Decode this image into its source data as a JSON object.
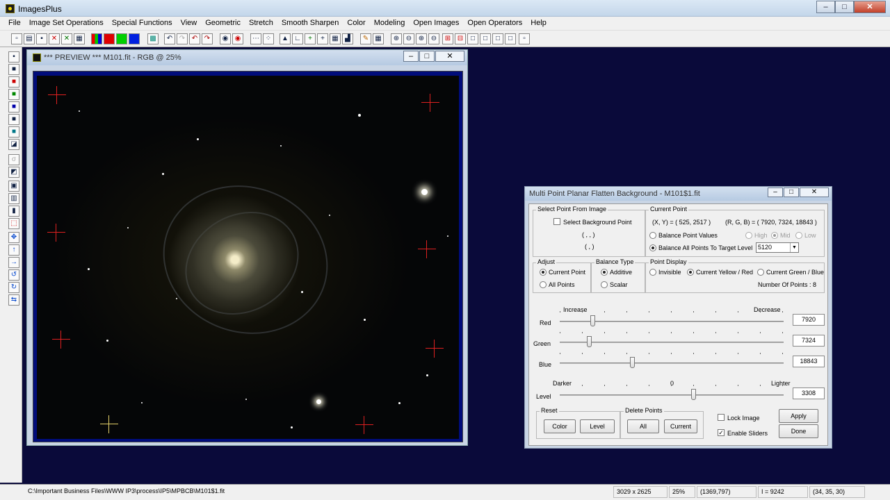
{
  "app": {
    "title": "ImagesPlus"
  },
  "menu": [
    "File",
    "Image Set Operations",
    "Special Functions",
    "View",
    "Geometric",
    "Stretch",
    "Smooth Sharpen",
    "Color",
    "Modeling",
    "Open Images",
    "Open Operators",
    "Help"
  ],
  "preview": {
    "title": "*** PREVIEW *** M101.fit - RGB @ 25%"
  },
  "dialog": {
    "title": "Multi Point Planar Flatten Background - M101$1.fit",
    "select_point": {
      "legend": "Select Point From Image",
      "checkbox_label": "Select Background Point",
      "coord_xyz": "( , , )",
      "coord_xy": "( , )"
    },
    "current_point": {
      "legend": "Current Point",
      "xy": "(X, Y) = ( 525, 2517 )",
      "rgb": "(R, G, B) = ( 7920, 7324, 18843 )",
      "balance_values": "Balance Point Values",
      "high": "High",
      "mid": "Mid",
      "low": "Low",
      "balance_all": "Balance All Points To Target Level",
      "target_level": "5120"
    },
    "adjust": {
      "legend": "Adjust",
      "current": "Current Point",
      "all": "All Points"
    },
    "balance_type": {
      "legend": "Balance Type",
      "additive": "Additive",
      "scalar": "Scalar"
    },
    "point_display": {
      "legend": "Point Display",
      "invisible": "Invisible",
      "yellow_red": "Current Yellow / Red",
      "green_blue": "Current Green / Blue",
      "count": "Number Of Points : 8"
    },
    "sliders": {
      "increase": "Increase",
      "decrease": "Decrease",
      "darker": "Darker",
      "zero": "0",
      "lighter": "Lighter",
      "red": {
        "label": "Red",
        "value": "7920",
        "pos": 0.14
      },
      "green": {
        "label": "Green",
        "value": "7324",
        "pos": 0.125
      },
      "blue": {
        "label": "Blue",
        "value": "18843",
        "pos": 0.32
      },
      "level": {
        "label": "Level",
        "value": "3308",
        "pos": 0.6
      }
    },
    "reset": {
      "legend": "Reset",
      "color": "Color",
      "level": "Level"
    },
    "delete_points": {
      "legend": "Delete Points",
      "all": "All",
      "current": "Current"
    },
    "lock_image": "Lock Image",
    "enable_sliders": "Enable Sliders",
    "apply": "Apply",
    "done": "Done"
  },
  "status": {
    "path": "C:\\Important Business Files\\WWW IP3\\process\\IP5\\MPBCB\\M101$1.fit",
    "size": "3029 x 2625",
    "zoom": "25%",
    "coords": "(1369,797)",
    "intensity": "I = 9242",
    "rgb": "(34, 35, 30)"
  },
  "colors": {
    "desktop": "#0a0a3a",
    "canvas_border": "#000c7a",
    "marker_red": "#e02020",
    "marker_yellow": "#e6d36a"
  }
}
